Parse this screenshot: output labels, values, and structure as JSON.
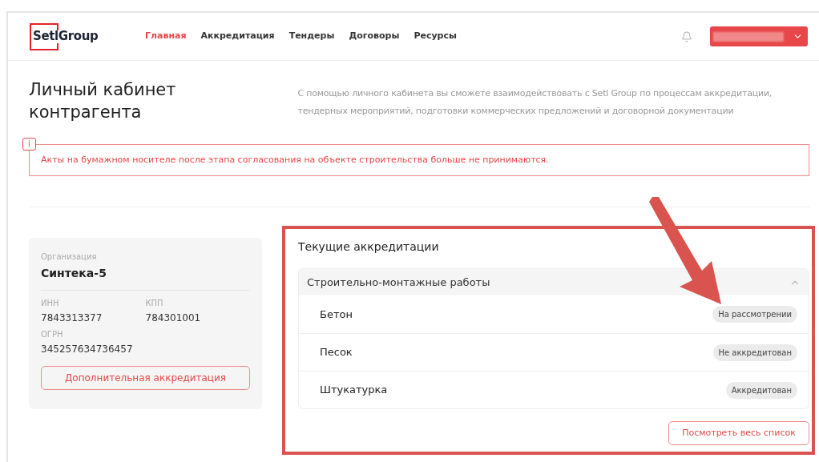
{
  "header": {
    "logo": "SetlGroup",
    "nav": [
      {
        "label": "Главная",
        "selected": true
      },
      {
        "label": "Аккредитация",
        "selected": false
      },
      {
        "label": "Тендеры",
        "selected": false
      },
      {
        "label": "Договоры",
        "selected": false
      },
      {
        "label": "Ресурсы",
        "selected": false
      }
    ]
  },
  "title": "Личный кабинет контрагента",
  "description": "С помощью личного кабинета вы сможете взаимодействовать с Setl Group по процессам аккредитации, тендерных мероприятий, подготовки коммерческих предложений и договорной документации",
  "alert": {
    "icon": "i",
    "text": "Акты на бумажном носителе после этапа согласования на объекте строительства больше не принимаются."
  },
  "organization": {
    "label": "Организация",
    "name": "Синтека-5",
    "fields": [
      {
        "label": "ИНН",
        "value": "7843313377"
      },
      {
        "label": "КПП",
        "value": "784301001"
      },
      {
        "label": "ОГРН",
        "value": "345257634736457"
      }
    ],
    "button": "Дополнительная аккредитация"
  },
  "accreditations": {
    "title": "Текущие аккредитации",
    "group": {
      "title": "Строительно-монтажные работы",
      "expanded": true,
      "items": [
        {
          "name": "Бетон",
          "status": "На рассмотрении"
        },
        {
          "name": "Песок",
          "status": "Не аккредитован"
        },
        {
          "name": "Штукатурка",
          "status": "Аккредитован"
        }
      ]
    },
    "button": "Посмотреть весь список"
  }
}
